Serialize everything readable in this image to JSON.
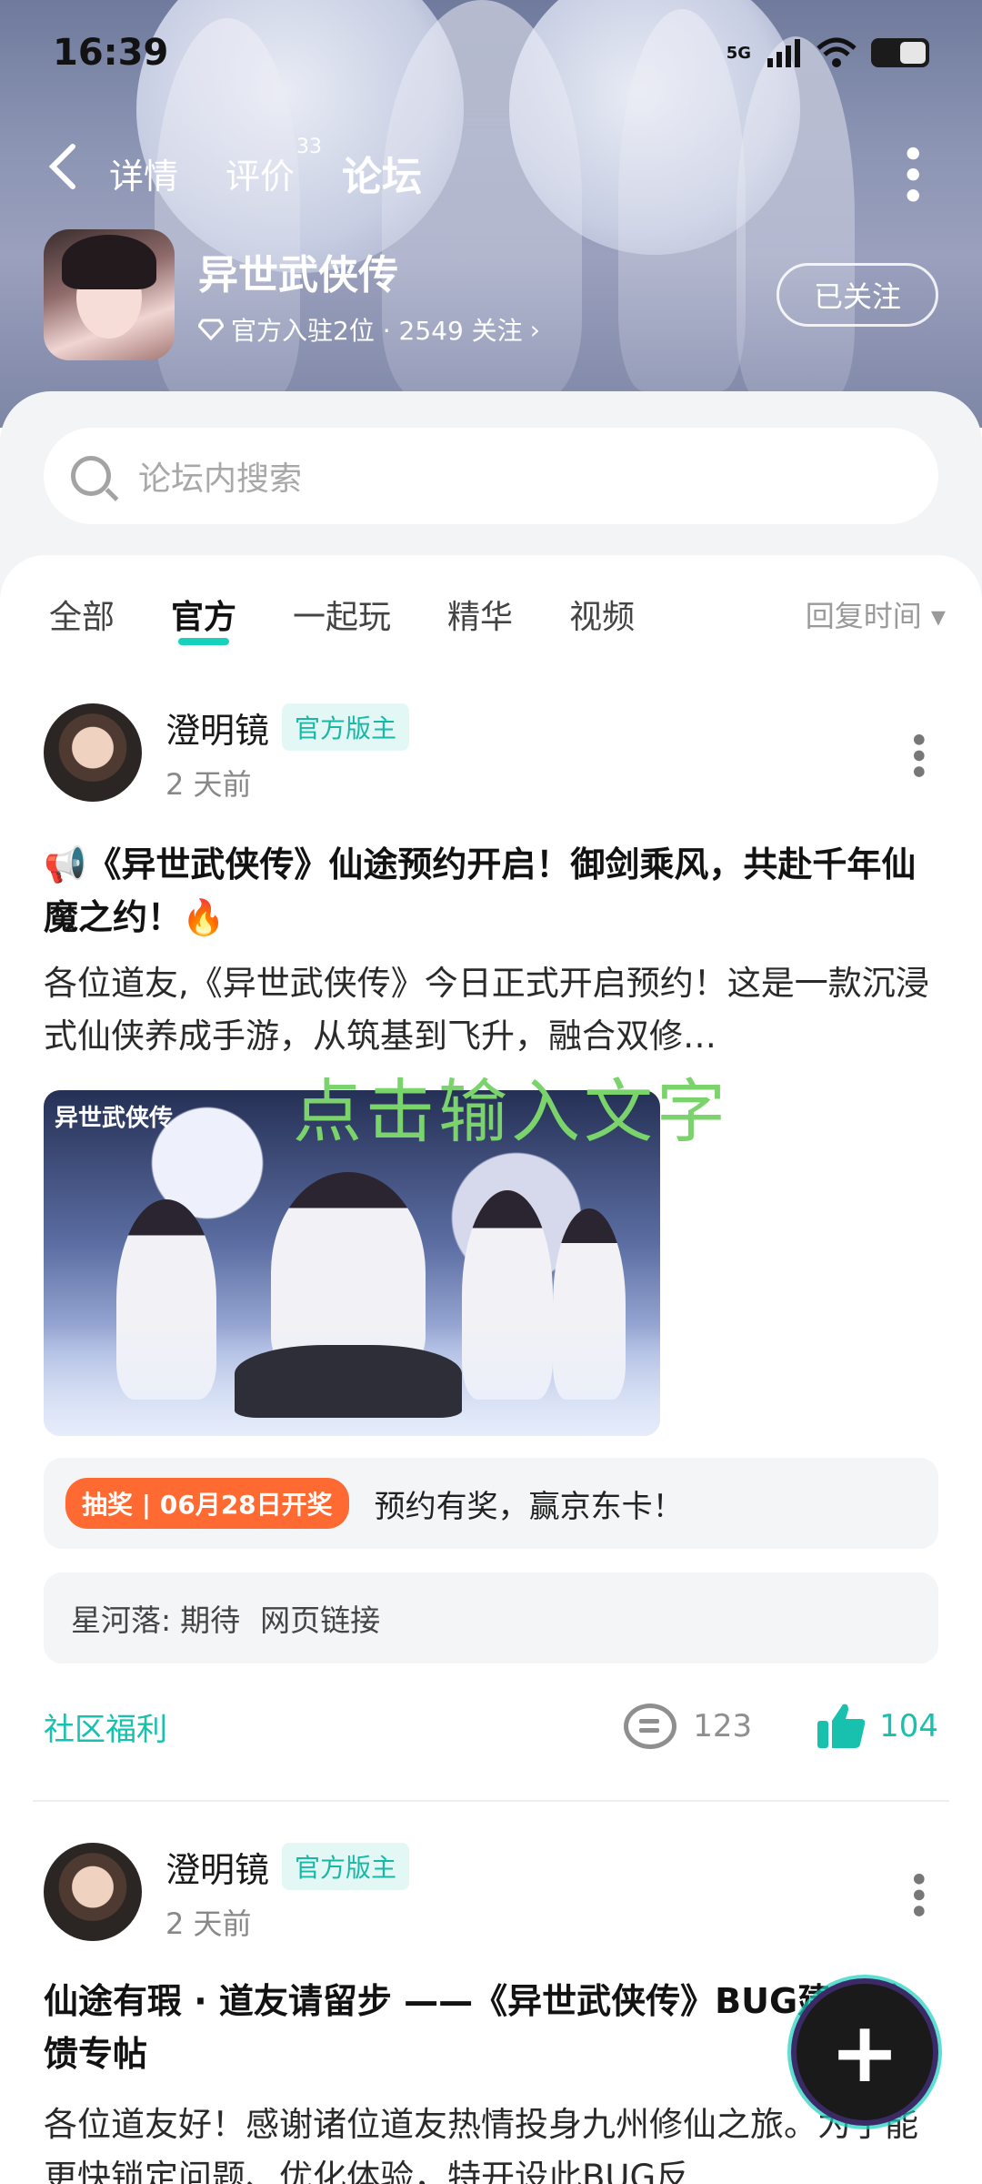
{
  "status_bar": {
    "time": "16:39",
    "network": "5G"
  },
  "nav": {
    "tabs": [
      {
        "label": "详情"
      },
      {
        "label": "评价",
        "badge": "33"
      },
      {
        "label": "论坛"
      }
    ]
  },
  "game": {
    "title": "异世武侠传",
    "meta": "官方入驻2位 · 2549 关注",
    "follow_label": "已关注"
  },
  "search": {
    "placeholder": "论坛内搜索"
  },
  "filter_tabs": [
    "全部",
    "官方",
    "一起玩",
    "精华",
    "视频"
  ],
  "sort_label": "回复时间 ▾",
  "overlay_text": "点击输入文字",
  "posts": [
    {
      "author": "澄明镜",
      "role": "官方版主",
      "time": "2 天前",
      "title": "📢《异世武侠传》仙途预约开启！御剑乘风，共赴千年仙魔之约！🔥",
      "body": "各位道友,《异世武侠传》今日正式开启预约！这是一款沉浸式仙侠养成手游，从筑基到飞升，融合双修…",
      "image_logo": "异世武侠传",
      "promo_tag": "抽奖 | 06月28日开奖",
      "promo_text": "预约有奖，赢京东卡！",
      "comment_user": "星河落:",
      "comment_text": "期待",
      "comment_link": "网页链接",
      "category": "社区福利",
      "comments": "123",
      "likes": "104"
    },
    {
      "author": "澄明镜",
      "role": "官方版主",
      "time": "2 天前",
      "title": "仙途有瑕 · 道友请留步 ——《异世武侠传》BUG建议反馈专帖",
      "body": "各位道友好！感谢诸位道友热情投身九州修仙之旅。为了能更快锁定问题、优化体验，特开设此BUG反…"
    }
  ],
  "fab_label": "+"
}
